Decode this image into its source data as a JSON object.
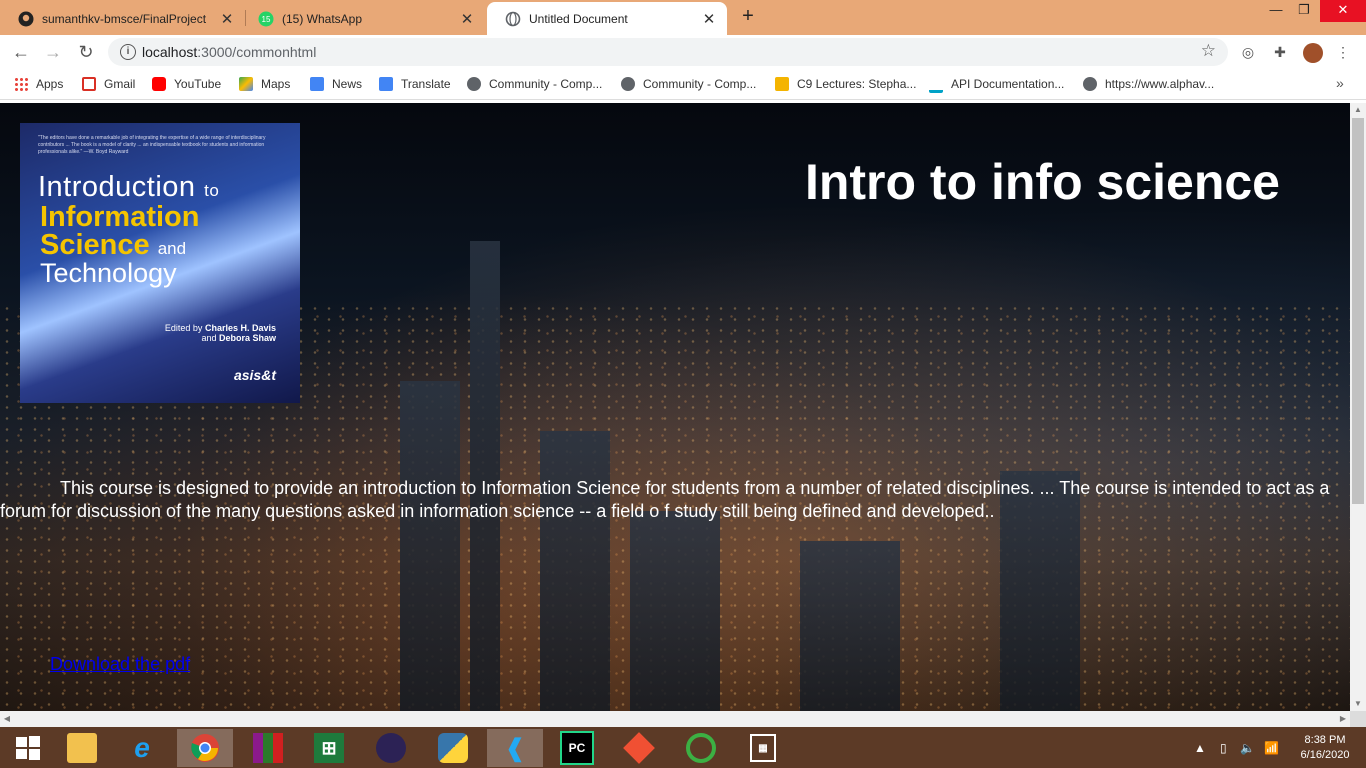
{
  "browser": {
    "tabs": [
      {
        "title": "sumanthkv-bmsce/FinalProject",
        "icon": "github-icon",
        "active": false
      },
      {
        "title": "(15) WhatsApp",
        "icon": "whatsapp-icon",
        "active": false
      },
      {
        "title": "Untitled Document",
        "icon": "globe-icon",
        "active": true
      }
    ],
    "new_tab_label": "+",
    "url_host": "localhost",
    "url_rest": ":3000/commonhtml",
    "bookmarks": [
      {
        "label": "Apps",
        "icon": "apps-grid-icon",
        "color": "#e8453c"
      },
      {
        "label": "Gmail",
        "icon": "gmail-icon",
        "color": "#d93025"
      },
      {
        "label": "YouTube",
        "icon": "youtube-icon",
        "color": "#ff0000"
      },
      {
        "label": "Maps",
        "icon": "maps-icon",
        "color": "#34a853"
      },
      {
        "label": "News",
        "icon": "news-icon",
        "color": "#4285f4"
      },
      {
        "label": "Translate",
        "icon": "translate-icon",
        "color": "#4285f4"
      },
      {
        "label": "Community - Comp...",
        "icon": "globe-icon",
        "color": "#5f6368"
      },
      {
        "label": "Community - Comp...",
        "icon": "globe-icon",
        "color": "#5f6368"
      },
      {
        "label": "C9 Lectures: Stepha...",
        "icon": "c9-icon",
        "color": "#f4b400"
      },
      {
        "label": "API Documentation...",
        "icon": "api-icon",
        "color": "#00a2c7"
      },
      {
        "label": "https://www.alphav...",
        "icon": "globe-icon",
        "color": "#5f6368"
      }
    ]
  },
  "page": {
    "book": {
      "quote": "\"The editors have done a remarkable job of integrating the expertise of a wide range of interdisciplinary contributors ... The book is a model of clarity ... an indispensable textbook for students and information professionals alike.\" —W. Boyd Rayward",
      "title_line1": "Introduction",
      "title_to": "to",
      "title_line2": "Information",
      "title_line3": "Science",
      "title_and": "and",
      "title_line4": "Technology",
      "edited_by": "Edited by",
      "editor1": "Charles H. Davis",
      "editor_and": "and",
      "editor2": "Debora Shaw",
      "publisher_logo": "asis&t"
    },
    "heading": "Intro to info science",
    "paragraph": "This course is designed to provide an introduction to Information Science for students from a number of related disciplines. ... The course is intended to act as a forum for discussion of the many questions asked in information science -- a field o f study still being defined and developed..",
    "download_link": "Download the pdf"
  },
  "taskbar": {
    "apps": [
      {
        "name": "start",
        "icon": "windows-start-icon"
      },
      {
        "name": "file-explorer",
        "icon": "folder-icon"
      },
      {
        "name": "internet-explorer",
        "icon": "ie-icon"
      },
      {
        "name": "chrome",
        "icon": "chrome-icon",
        "active": true
      },
      {
        "name": "winrar",
        "icon": "winrar-icon"
      },
      {
        "name": "excel",
        "icon": "excel-icon"
      },
      {
        "name": "eclipse",
        "icon": "eclipse-icon"
      },
      {
        "name": "python",
        "icon": "python-icon"
      },
      {
        "name": "vscode",
        "icon": "vscode-icon",
        "active": true
      },
      {
        "name": "pycharm",
        "icon": "pycharm-icon"
      },
      {
        "name": "git",
        "icon": "git-icon"
      },
      {
        "name": "refresh-app",
        "icon": "circular-arrows-icon"
      },
      {
        "name": "building-app",
        "icon": "building-icon"
      }
    ],
    "time": "8:38 PM",
    "date": "6/16/2020"
  }
}
